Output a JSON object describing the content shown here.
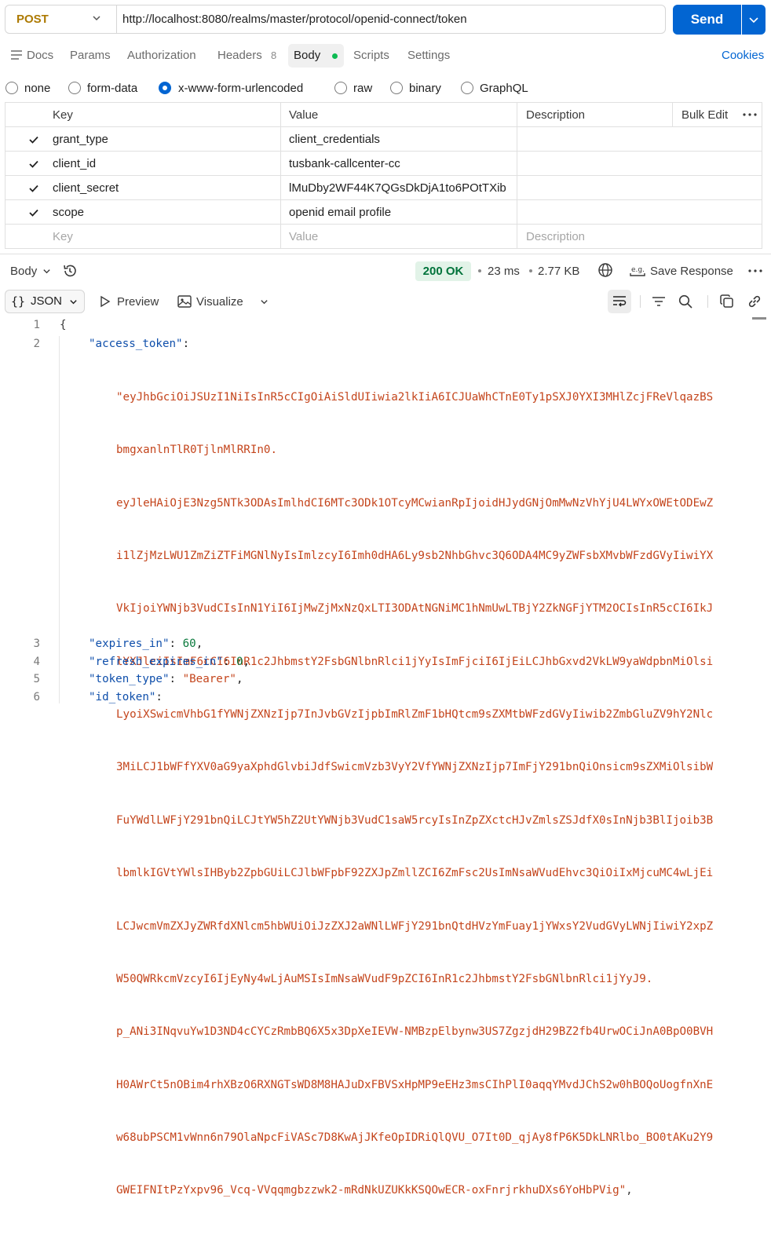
{
  "request": {
    "method": "POST",
    "url": "http://localhost:8080/realms/master/protocol/openid-connect/token",
    "send_label": "Send"
  },
  "tabs": {
    "docs": "Docs",
    "params": "Params",
    "authorization": "Authorization",
    "headers": "Headers",
    "headers_count": "8",
    "body": "Body",
    "scripts": "Scripts",
    "settings": "Settings",
    "cookies": "Cookies"
  },
  "body_types": [
    "none",
    "form-data",
    "x-www-form-urlencoded",
    "raw",
    "binary",
    "GraphQL"
  ],
  "body_type_selected": "x-www-form-urlencoded",
  "params_table": {
    "headers": {
      "key": "Key",
      "value": "Value",
      "description": "Description",
      "bulk_edit": "Bulk Edit"
    },
    "rows": [
      {
        "key": "grant_type",
        "value": "client_credentials"
      },
      {
        "key": "client_id",
        "value": "tusbank-callcenter-cc"
      },
      {
        "key": "client_secret",
        "value": "lMuDby2WF44K7QGsDkDjA1to6POtTXib"
      },
      {
        "key": "scope",
        "value": "openid email profile"
      }
    ],
    "placeholders": {
      "key": "Key",
      "value": "Value",
      "description": "Description"
    }
  },
  "response": {
    "section_label": "Body",
    "status": "200 OK",
    "time": "23 ms",
    "size": "2.77 KB",
    "save_label": "Save Response",
    "format": "JSON",
    "preview_label": "Preview",
    "visualize_label": "Visualize"
  },
  "code": {
    "line_numbers": [
      "1",
      "2",
      "3",
      "4",
      "5",
      "6"
    ],
    "open_brace": "{",
    "access_token_key": "\"access_token\"",
    "access_token_lines": [
      "\"eyJhbGciOiJSUzI1NiIsInR5cCIgOiAiSldUIiwia2lkIiA6ICJUaWhCTnE0Ty1pSXJ0YXI3MHlZcjFReVlqazBS",
      "bmgxanlnTlR0TjlnMlRRIn0.",
      "eyJleHAiOjE3Nzg5NTk3ODAsImlhdCI6MTc3ODk1OTcyMCwianRpIjoidHJydGNjOmMwNzVhYjU4LWYxOWEtODEwZ",
      "i1lZjMzLWU1ZmZiZTFiMGNlNyIsImlzcyI6Imh0dHA6Ly9sb2NhbGhvc3Q6ODA4MC9yZWFsbXMvbWFzdGVyIiwiYX",
      "VkIjoiYWNjb3VudCIsInN1YiI6IjMwZjMxNzQxLTI3ODAtNGNiMC1hNmUwLTBjY2ZkNGFjYTM2OCIsInR5cCI6IkJ",
      "lYXJlciIsImF6cCI6InR1c2JhbmstY2FsbGNlbnRlci1jYyIsImFjciI6IjEiLCJhbGxvd2VkLW9yaWdpbnMiOlsi",
      "LyoiXSwicmVhbG1fYWNjZXNzIjp7InJvbGVzIjpbImRlZmF1bHQtcm9sZXMtbWFzdGVyIiwib2ZmbGluZV9hY2Nlc",
      "3MiLCJ1bWFfYXV0aG9yaXphdGlvbiJdfSwicmVzb3VyY2VfYWNjZXNzIjp7ImFjY291bnQiOnsicm9sZXMiOlsibW",
      "FuYWdlLWFjY291bnQiLCJtYW5hZ2UtYWNjb3VudC1saW5rcyIsInZpZXctcHJvZmlsZSJdfX0sInNjb3BlIjoib3B",
      "lbmlkIGVtYWlsIHByb2ZpbGUiLCJlbWFpbF92ZXJpZmllZCI6ZmFsc2UsImNsaWVudEhvc3QiOiIxMjcuMC4wLjEi",
      "LCJwcmVmZXJyZWRfdXNlcm5hbWUiOiJzZXJ2aWNlLWFjY291bnQtdHVzYmFuay1jYWxsY2VudGVyLWNjIiwiY2xpZ",
      "W50QWRkcmVzcyI6IjEyNy4wLjAuMSIsImNsaWVudF9pZCI6InR1c2JhbmstY2FsbGNlbnRlci1jYyJ9.",
      "p_ANi3INqvuYw1D3ND4cCYCzRmbBQ6X5x3DpXeIEVW-NMBzpElbynw3US7ZgzjdH29BZ2fb4UrwOCiJnA0BpO0BVH",
      "H0AWrCt5nOBim4rhXBzO6RXNGTsWD8M8HAJuDxFBVSxHpMP9eEHz3msCIhPlI0aqqYMvdJChS2w0hBOQoUogfnXnE",
      "w68ubPSCM1vWnn6n79OlaNpcFiVASc7D8KwAjJKfeOpIDRiQlQVU_O7It0D_qjAy8fP6K5DkLNRlbo_BO0tAKu2Y9",
      "GWEIFNItPzYxpv96_Vcq-VVqqmgbzzwk2-mRdNkUZUKkKSQOwECR-oxFnrjrkhuDXs6YoHbPVig\""
    ],
    "access_token_end": ",",
    "expires_in_key": "\"expires_in\"",
    "expires_in_value": "60",
    "refresh_expires_in_key": "\"refresh_expires_in\"",
    "refresh_expires_in_value": "0",
    "token_type_key": "\"token_type\"",
    "token_type_value": "\"Bearer\"",
    "id_token_key": "\"id_token\""
  }
}
